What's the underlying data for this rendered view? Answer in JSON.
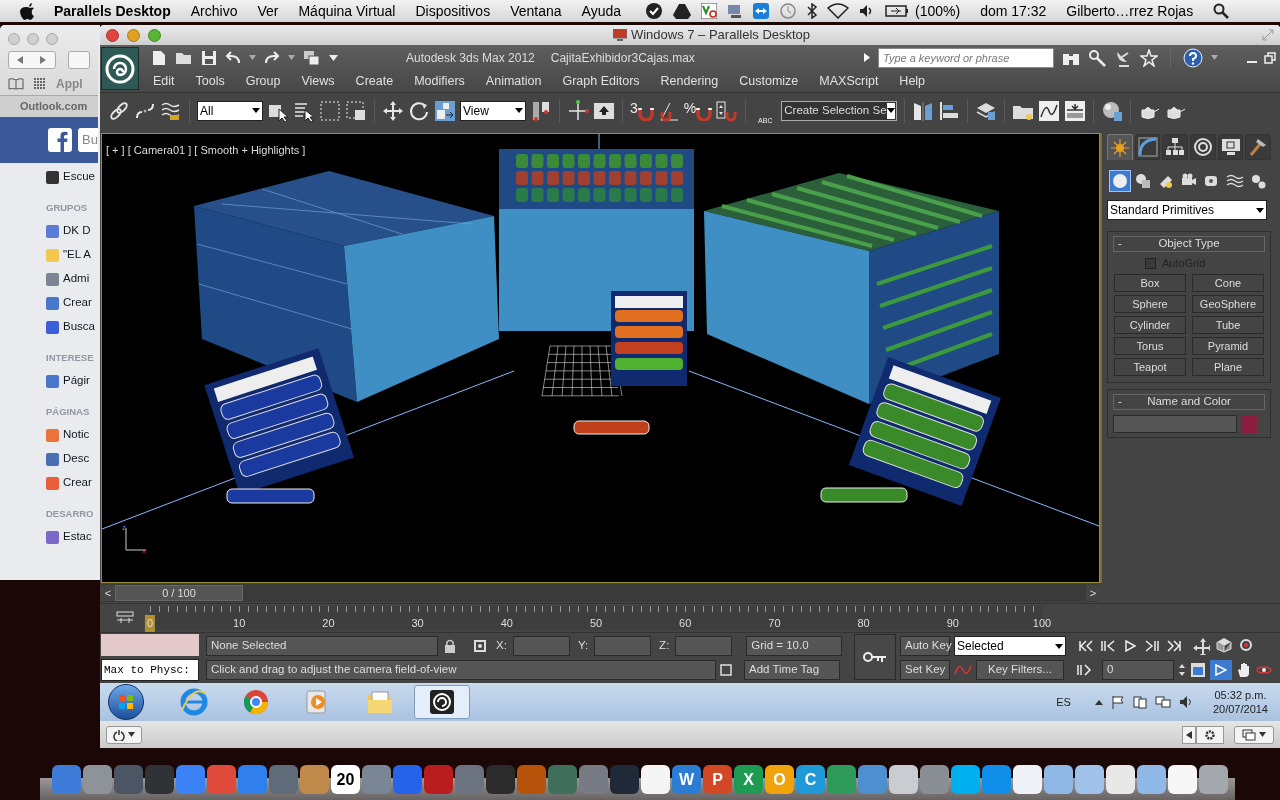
{
  "mac_menubar": {
    "app": "Parallels Desktop",
    "menus": [
      "Archivo",
      "Ver",
      "Máquina Virtual",
      "Dispositivos",
      "Ventana",
      "Ayuda"
    ],
    "battery": "(100%)",
    "clock": "dom 17:32",
    "user": "Gilberto…rrez Rojas"
  },
  "browser": {
    "bookmark": "Appl",
    "tab": "Outlook.com",
    "search_placeholder": "Bu",
    "sidebar": [
      {
        "kind": "link",
        "label": "Escue",
        "color": "#333333"
      },
      {
        "kind": "heading",
        "label": "GRUPOS"
      },
      {
        "kind": "link",
        "label": "DK D",
        "color": "#5b7bd5"
      },
      {
        "kind": "link",
        "label": "\"EL A",
        "color": "#f2c94c"
      },
      {
        "kind": "link",
        "label": "Admi",
        "color": "#7d8593"
      },
      {
        "kind": "link",
        "label": "Crear",
        "color": "#4a76c9"
      },
      {
        "kind": "link",
        "label": "Busca",
        "color": "#3b5fd9"
      },
      {
        "kind": "heading",
        "label": "INTERESE"
      },
      {
        "kind": "link",
        "label": "Págir",
        "color": "#4a76c9"
      },
      {
        "kind": "heading",
        "label": "PÁGINAS"
      },
      {
        "kind": "link",
        "label": "Notic",
        "color": "#e8743b"
      },
      {
        "kind": "link",
        "label": "Desc",
        "color": "#4a6fb5"
      },
      {
        "kind": "link",
        "label": "Crear",
        "color": "#e8603b"
      },
      {
        "kind": "heading",
        "label": "DESARRO"
      },
      {
        "kind": "link",
        "label": "Estac",
        "color": "#7b68c8"
      }
    ]
  },
  "vm_window": {
    "title": "Windows 7 – Parallels Desktop"
  },
  "app": {
    "product": "Autodesk 3ds Max  2012",
    "file": "CajitaExhibidor3Cajas.max",
    "search": {
      "placeholder": "Type a keyword or phrase"
    },
    "menus": [
      "Edit",
      "Tools",
      "Group",
      "Views",
      "Create",
      "Modifiers",
      "Animation",
      "Graph Editors",
      "Rendering",
      "Customize",
      "MAXScript",
      "Help"
    ],
    "toolbar": {
      "selection_filter": "All",
      "coordinate_system": "View",
      "snap_toggle": "3",
      "percent_snap": "%",
      "named_selection_icon": "ABC",
      "named_selection": "Create Selection Se"
    }
  },
  "viewport": {
    "label": "[ + ] [ Camera01 ] [ Smooth + Highlights ]",
    "axis_vertical": "z",
    "axis_horizontal": "x"
  },
  "command_panel": {
    "tabs": [
      {
        "selected": true
      },
      {
        "selected": false
      },
      {
        "selected": false
      },
      {
        "selected": false
      },
      {
        "selected": false
      },
      {
        "selected": false
      }
    ],
    "categories": [
      {
        "selected": true
      },
      {
        "selected": false
      },
      {
        "selected": false
      },
      {
        "selected": false
      },
      {
        "selected": false
      },
      {
        "selected": false
      },
      {
        "selected": false
      }
    ],
    "object_class": "Standard Primitives",
    "object_type": {
      "toggle": "-",
      "title": "Object Type",
      "autogrid": {
        "label": "AutoGrid",
        "checked": false
      },
      "buttons": [
        "Box",
        "Cone",
        "Sphere",
        "GeoSphere",
        "Cylinder",
        "Tube",
        "Torus",
        "Pyramid",
        "Teapot",
        "Plane"
      ]
    },
    "name_and_color": {
      "toggle": "-",
      "title": "Name and Color",
      "color": "#8b1e3f"
    }
  },
  "timeline": {
    "prev": "<",
    "frame": "0 / 100",
    "next": ">",
    "ticks": [
      "0",
      "10",
      "20",
      "30",
      "40",
      "50",
      "60",
      "70",
      "80",
      "90",
      "100"
    ]
  },
  "status": {
    "listener": "Max to Physc:",
    "selection": "None Selected",
    "x_label": "X:",
    "y_label": "Y:",
    "z_label": "Z:",
    "grid": "Grid = 10.0",
    "prompt": "Click and drag to adjust the camera field-of-view",
    "time_tag": "Add Time Tag",
    "auto_key": "Auto Key",
    "key_mode": "Selected",
    "set_key": "Set Key",
    "key_filters": "Key Filters...",
    "current_frame": "0"
  },
  "taskbar": {
    "apps": [
      {
        "kind": "ie",
        "selected": false
      },
      {
        "kind": "chrome",
        "selected": false
      },
      {
        "kind": "media",
        "selected": false
      },
      {
        "kind": "explorer",
        "selected": false
      },
      {
        "kind": "max",
        "selected": true
      }
    ],
    "language": "ES",
    "time": "05:32 p.m.",
    "date": "20/07/2014"
  },
  "dock": [
    {
      "color": "#3d7bd9"
    },
    {
      "color": "#8e9399"
    },
    {
      "color": "#4b5563"
    },
    {
      "color": "#2f3338"
    },
    {
      "color": "#3b82f6"
    },
    {
      "color": "#e04a3b"
    },
    {
      "color": "#2f80ed"
    },
    {
      "color": "#5f6b78"
    },
    {
      "color": "#c08a4a"
    },
    {
      "color": "#ffffff",
      "glyph": "20"
    },
    {
      "color": "#7a8694"
    },
    {
      "color": "#2563eb"
    },
    {
      "color": "#b91c1c"
    },
    {
      "color": "#6b7280"
    },
    {
      "color": "#2b2b2b"
    },
    {
      "color": "#b45309"
    },
    {
      "color": "#3f6e5a"
    },
    {
      "color": "#777c84"
    },
    {
      "color": "#1f2937"
    },
    {
      "color": "#f5f5f5"
    },
    {
      "color": "#2b7cd3",
      "glyph": "W"
    },
    {
      "color": "#d24726",
      "glyph": "P"
    },
    {
      "color": "#1e9b52",
      "glyph": "X"
    },
    {
      "color": "#f0a30a",
      "glyph": "O"
    },
    {
      "color": "#1f9ad6",
      "glyph": "C"
    },
    {
      "color": "#2e9a5a"
    },
    {
      "color": "#4d8fcf"
    },
    {
      "color": "#c9ccd1"
    },
    {
      "color": "#8a8f96"
    },
    {
      "color": "#00aff0"
    },
    {
      "color": "#0e8ee9"
    },
    {
      "color": "#eef2f7"
    },
    {
      "color": "#8fb8e6"
    },
    {
      "color": "#9fc2ea"
    },
    {
      "color": "#e8e8e8"
    },
    {
      "color": "#8fb8e6"
    },
    {
      "color": "#f7f7f7"
    },
    {
      "color": "#a3a8ae"
    }
  ]
}
